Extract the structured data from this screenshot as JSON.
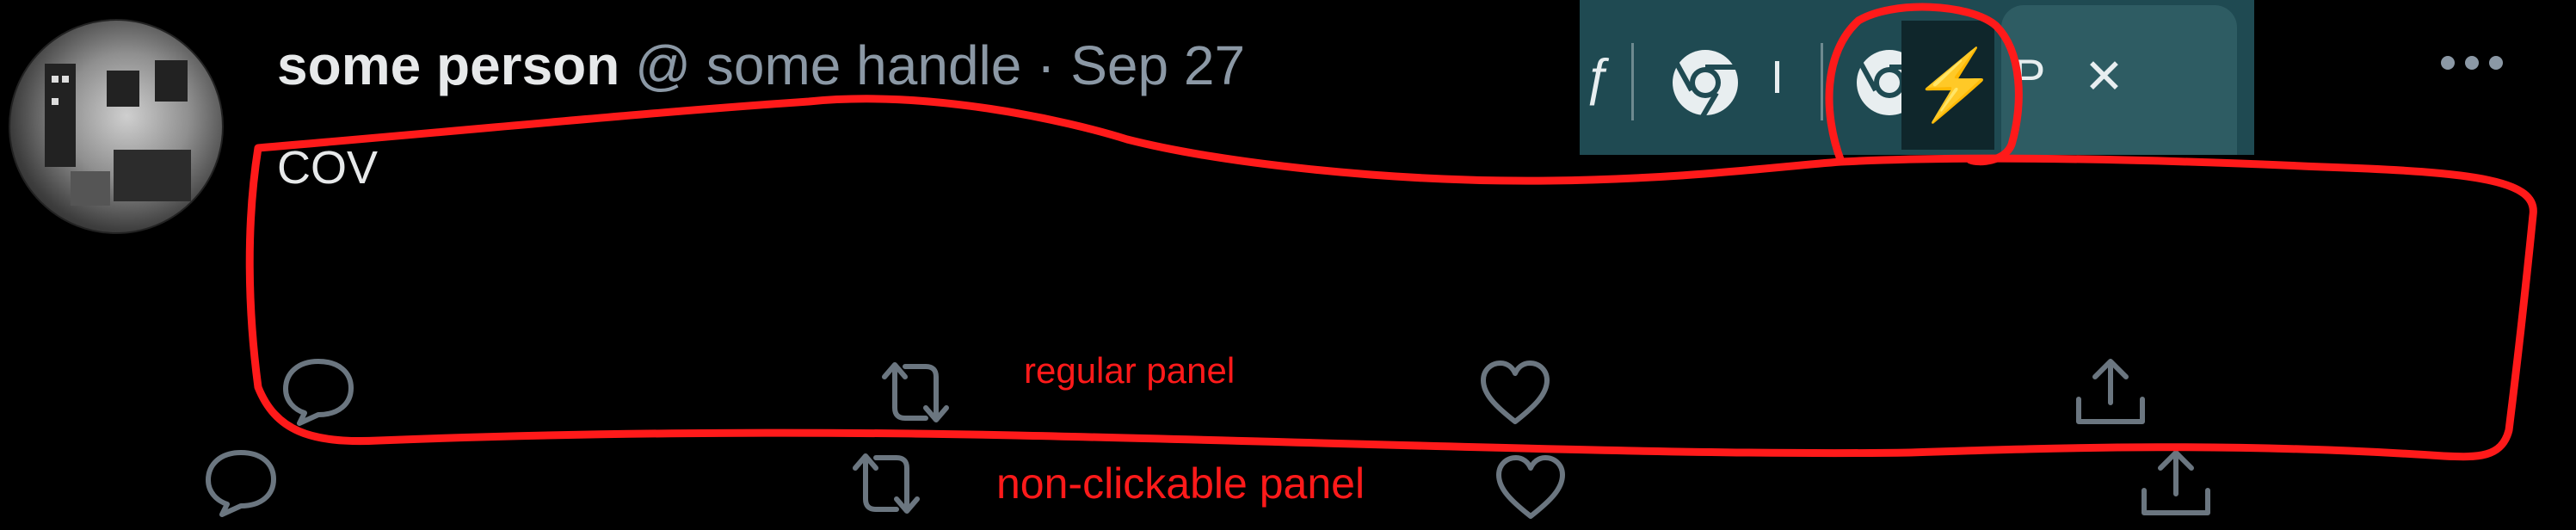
{
  "post": {
    "author_name": "some person",
    "author_handle": "@ some handle",
    "separator": "·",
    "date": "Sep 27",
    "text": "COV"
  },
  "tab_strip": {
    "close_glyph": "✕",
    "tab_letter": "P",
    "bolt_glyph": "⚡",
    "fragment_glyph": "ƒ",
    "cursor_glyph": "I"
  },
  "panels": {
    "regular_label": "regular panel",
    "nonclickable_label": "non-clickable panel"
  },
  "icons": {
    "reply": "reply-icon",
    "repost": "repost-icon",
    "like": "like-icon",
    "share": "share-icon",
    "more": "more-icon",
    "chrome": "chrome-icon"
  },
  "colors": {
    "annotation": "#ff1a1a",
    "tab_strip": "#1f4a52",
    "active_tab": "#2e5c63",
    "muted_text": "#8b98a5",
    "action_icon": "#6b7680"
  }
}
